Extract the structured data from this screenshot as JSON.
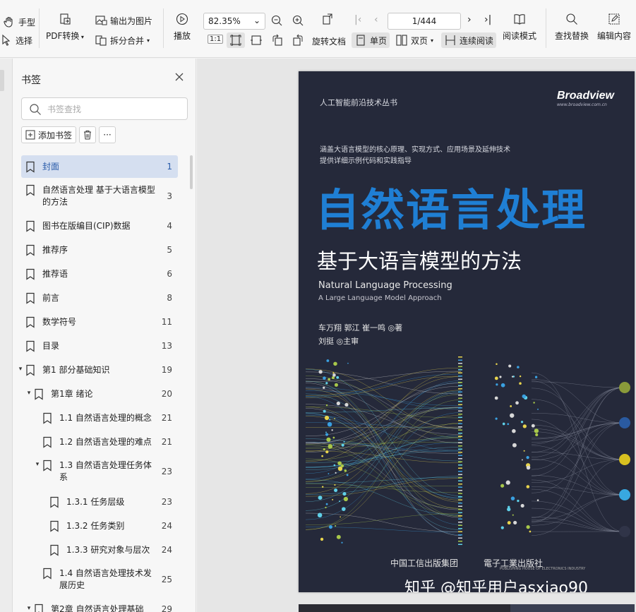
{
  "toolbar": {
    "hand_tool": "手型",
    "select_tool": "选择",
    "pdf_convert": "PDF转换",
    "export_image": "输出为图片",
    "split_merge": "拆分合并",
    "play": "播放",
    "zoom_value": "82.35%",
    "actual_size": "1:1",
    "rotate_doc": "旋转文档",
    "page_indicator": "1/444",
    "single_page": "单页",
    "double_page": "双页",
    "continuous_read": "连续阅读",
    "read_mode": "阅读模式",
    "find_replace": "查找替换",
    "edit_content": "编辑内容"
  },
  "sidebar": {
    "title": "书签",
    "search_placeholder": "书签查找",
    "add_bookmark": "添加书签",
    "more": "···",
    "items": [
      {
        "label": "封面",
        "page": "1"
      },
      {
        "label": "自然语言处理  基于大语言模型",
        "label2": "的方法",
        "page": "3"
      },
      {
        "label": "图书在版编目(CIP)数据",
        "page": "4"
      },
      {
        "label": "推荐序",
        "page": "5"
      },
      {
        "label": "推荐语",
        "page": "6"
      },
      {
        "label": "前言",
        "page": "8"
      },
      {
        "label": "数学符号",
        "page": "11"
      },
      {
        "label": "目录",
        "page": "13"
      },
      {
        "label": "第1 部分基础知识",
        "page": "19"
      },
      {
        "label": "第1章 绪论",
        "page": "20"
      },
      {
        "label": "1.1 自然语言处理的概念",
        "page": "21"
      },
      {
        "label": "1.2 自然语言处理的难点",
        "page": "21"
      },
      {
        "label": "1.3 自然语言处理任务体",
        "label2": "系",
        "page": "23"
      },
      {
        "label": "1.3.1 任务层级",
        "page": "23"
      },
      {
        "label": "1.3.2 任务类别",
        "page": "24"
      },
      {
        "label": "1.3.3 研究对象与层次",
        "page": "24"
      },
      {
        "label": "1.4 自然语言处理技术发",
        "label2": "展历史",
        "page": "25"
      },
      {
        "label": "第2章 自然语言处理基础",
        "page": "29"
      }
    ]
  },
  "cover": {
    "series": "人工智能前沿技术丛书",
    "brand": "Broadview",
    "brand_url": "www.broadview.com.cn",
    "tagline1": "涵盖大语言模型的核心原理、实现方式、应用场景及延伸技术",
    "tagline2": "提供详细示例代码和实践指导",
    "title": "自然语言处理",
    "subtitle": "基于大语言模型的方法",
    "english_title": "Natural Language Processing",
    "english_subtitle": "A Large Language Model Approach",
    "authors": "车万翔  郭江  崔一鸣 ◎著",
    "editor": "刘挺 ◎主审",
    "publisher1": "中国工信出版集团",
    "publisher2": "電子工業出版社",
    "publisher2_en": "PUBLISHING HOUSE OF ELECTRONICS INDUSTRY",
    "watermark": "知乎 @知乎用户asxiao90"
  },
  "colors": {
    "accent": "#e0463f",
    "selection_bg": "#d5dff0",
    "selection_text": "#2a5caa",
    "cover_bg": "#25293a",
    "cover_title": "#1f7fd4"
  }
}
